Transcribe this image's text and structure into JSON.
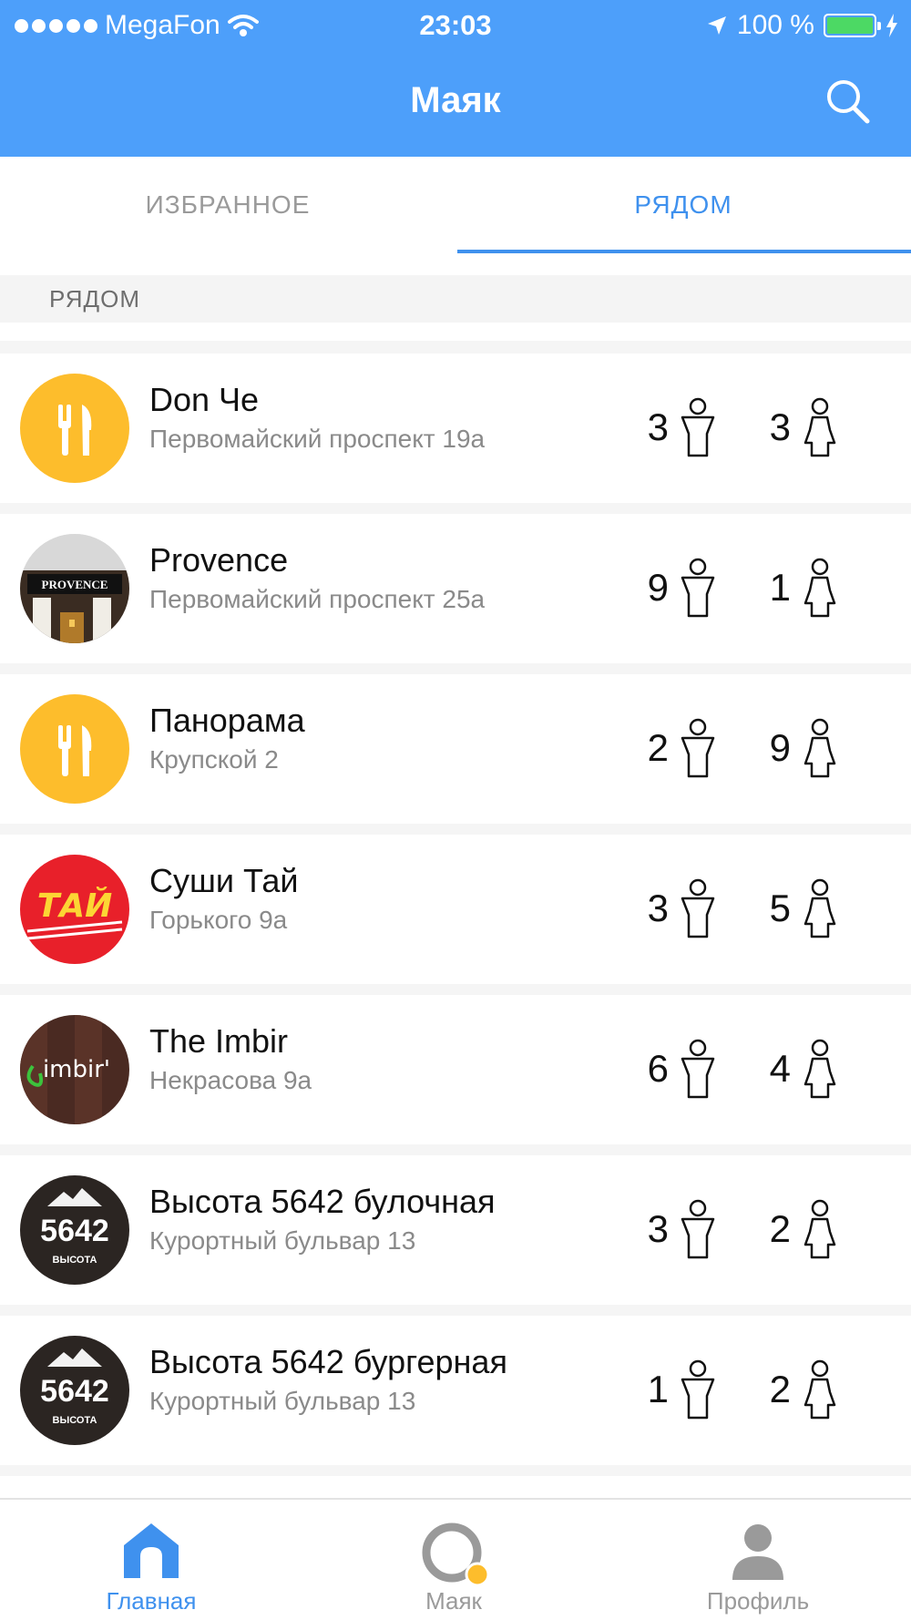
{
  "status_bar": {
    "carrier": "MegaFon",
    "time": "23:03",
    "battery": "100 %",
    "battery_level": 1.0,
    "icons": [
      "signal-dots-icon",
      "wifi-icon",
      "location-arrow-icon",
      "battery-icon",
      "charging-bolt-icon"
    ]
  },
  "nav": {
    "title": "Маяк",
    "search_icon": "search-icon"
  },
  "tabs": [
    {
      "label": "ИЗБРАННОЕ",
      "active": false
    },
    {
      "label": "РЯДОМ",
      "active": true
    }
  ],
  "section": {
    "title": "РЯДОМ"
  },
  "venues": [
    {
      "name": "Don Че",
      "address": "Первомайский проспект 19а",
      "male": "3",
      "female": "3",
      "avatar": "fork-knife-icon"
    },
    {
      "name": "Provence",
      "address": "Первомайский проспект 25а",
      "male": "9",
      "female": "1",
      "avatar": "provence-photo",
      "sign": "PROVENCE"
    },
    {
      "name": "Панорама",
      "address": "Крупской 2",
      "male": "2",
      "female": "9",
      "avatar": "fork-knife-icon"
    },
    {
      "name": "Суши Тай",
      "address": "Горького 9а",
      "male": "3",
      "female": "5",
      "avatar": "sushi-tai-logo",
      "logo_text": "ТАЙ"
    },
    {
      "name": "The Imbir",
      "address": "Некрасова 9а",
      "male": "6",
      "female": "4",
      "avatar": "imbir-logo",
      "logo_text": "imbir'"
    },
    {
      "name": "Высота 5642 булочная",
      "address": "Курортный бульвар 13",
      "male": "3",
      "female": "2",
      "avatar": "vysota-logo",
      "logo_number": "5642",
      "logo_caption": "ВЫСОТА"
    },
    {
      "name": "Высота 5642 бургерная",
      "address": "Курортный бульвар 13",
      "male": "1",
      "female": "2",
      "avatar": "vysota-logo",
      "logo_number": "5642",
      "logo_caption": "ВЫСОТА"
    }
  ],
  "tabbar": [
    {
      "label": "Главная",
      "icon": "home-icon",
      "active": true
    },
    {
      "label": "Маяк",
      "icon": "mayak-icon",
      "active": false
    },
    {
      "label": "Профиль",
      "icon": "profile-icon",
      "active": false
    }
  ],
  "colors": {
    "header": "#4d9ffa",
    "accent": "#3f91ee",
    "food_avatar": "#fdbd2c",
    "inactive": "#9a9a9a"
  }
}
